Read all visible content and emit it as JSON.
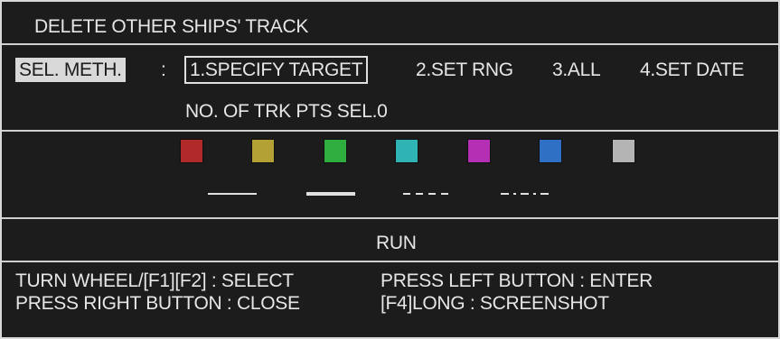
{
  "title": "DELETE OTHER SHIPS' TRACK",
  "method": {
    "label": "SEL. METH.",
    "separator": ":",
    "options": [
      "1.SPECIFY TARGET",
      "2.SET RNG",
      "3.ALL",
      "4.SET DATE"
    ],
    "selected_index": 0
  },
  "points_selected": "NO. OF TRK PTS SEL.0",
  "colors": [
    "#b02a2a",
    "#b3a135",
    "#2fae3f",
    "#2fb3b3",
    "#b52fb5",
    "#2f6fc4",
    "#b4b4b4"
  ],
  "line_styles": [
    "solid-thin",
    "solid-thick",
    "dashed",
    "dash-dot"
  ],
  "run_label": "RUN",
  "help": {
    "row1_left": "TURN WHEEL/[F1][F2] : SELECT",
    "row1_right": "PRESS LEFT BUTTON : ENTER",
    "row2_left": "PRESS RIGHT BUTTON : CLOSE",
    "row2_right": "[F4]LONG : SCREENSHOT"
  }
}
